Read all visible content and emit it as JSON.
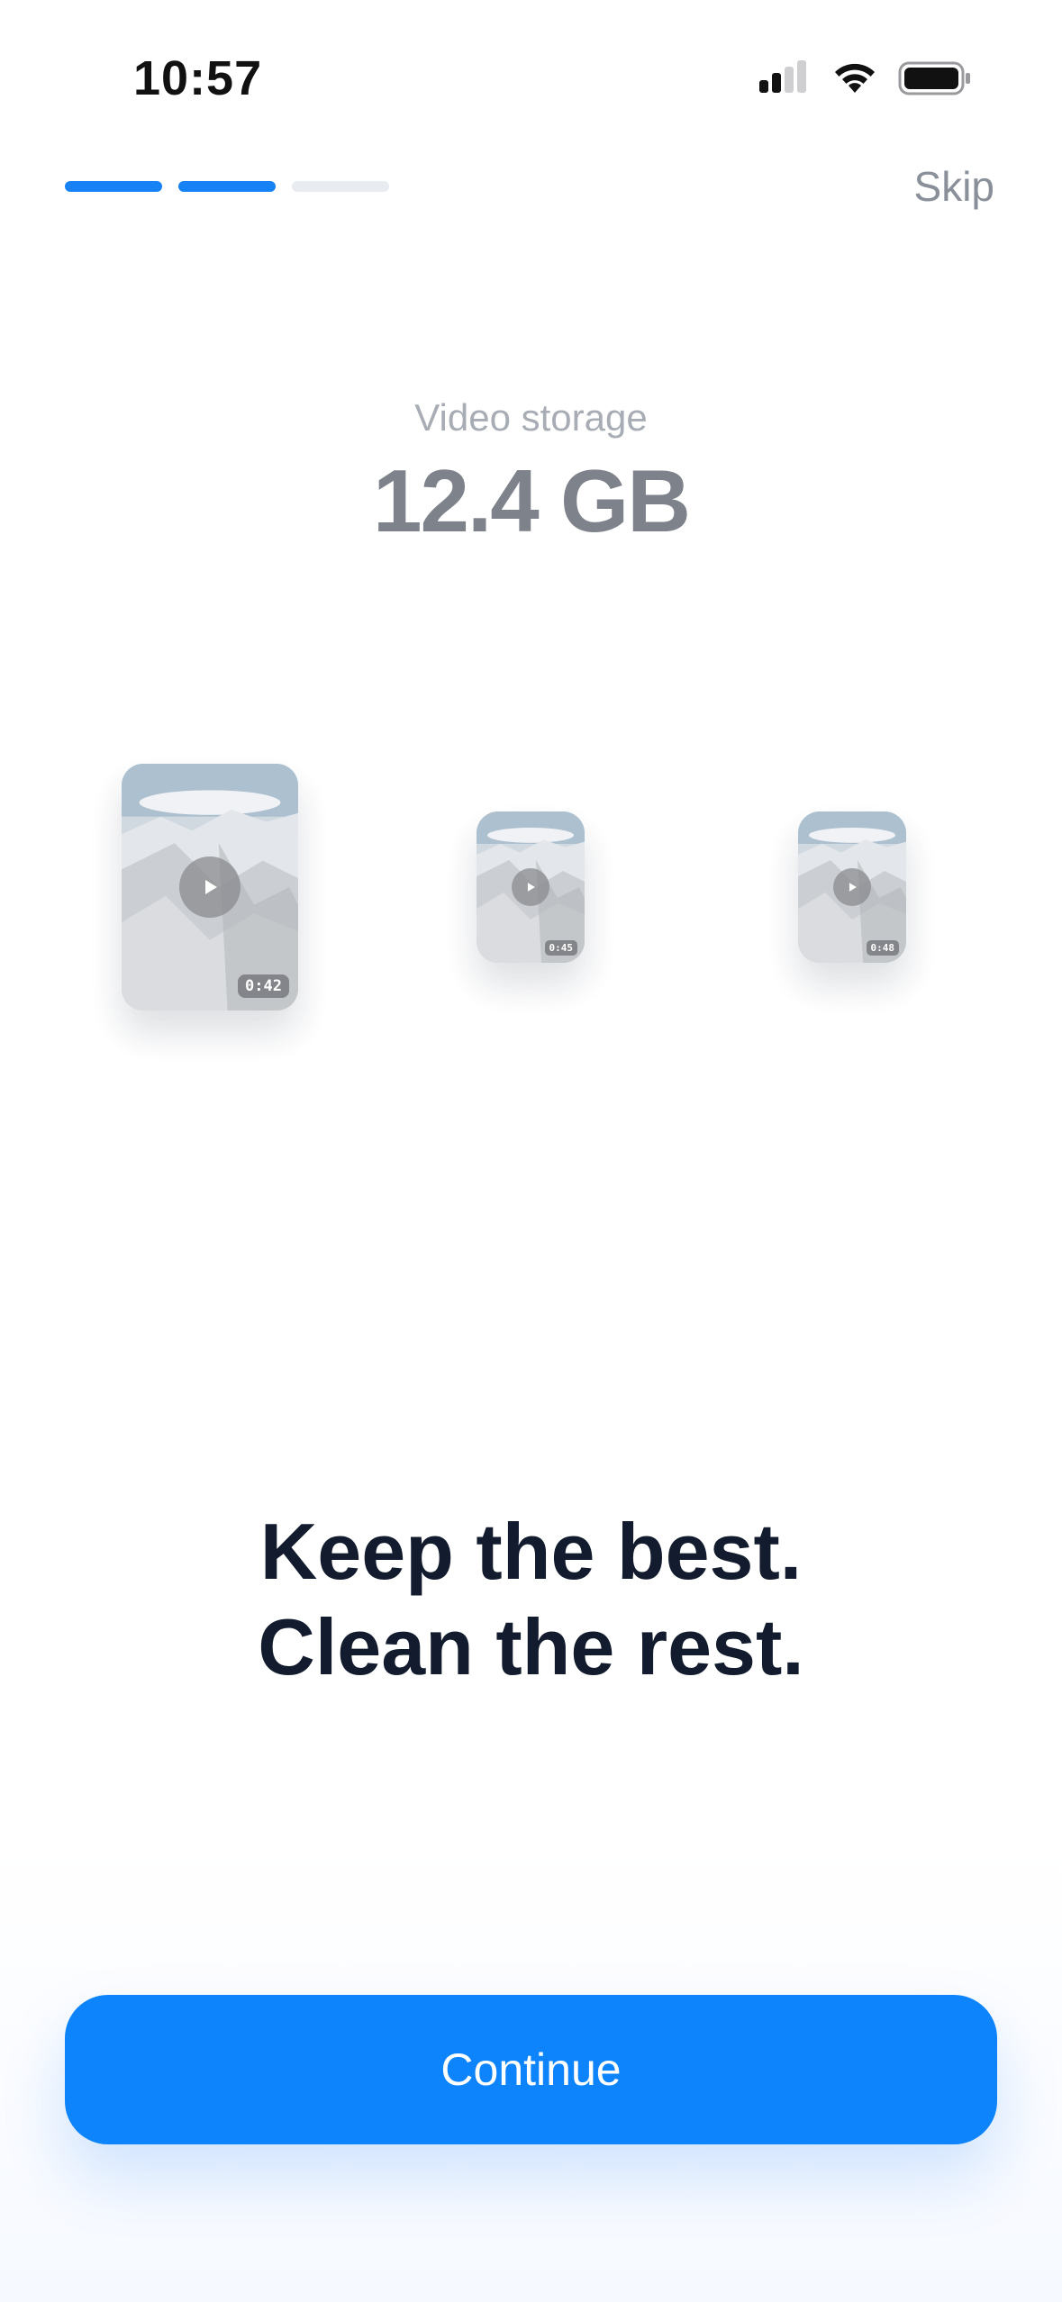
{
  "status_bar": {
    "time": "10:57",
    "icons": [
      "cellular-signal-icon",
      "wifi-icon",
      "battery-icon"
    ]
  },
  "onboarding": {
    "progress": {
      "total_steps": 3,
      "current_step": 2
    },
    "skip_label": "Skip"
  },
  "storage": {
    "label": "Video storage",
    "value": "12.4 GB"
  },
  "videos": [
    {
      "duration": "0:42"
    },
    {
      "duration": "0:45"
    },
    {
      "duration": "0:48"
    }
  ],
  "headline": {
    "line1": "Keep the best.",
    "line2": "Clean the rest."
  },
  "cta": {
    "continue_label": "Continue"
  },
  "colors": {
    "accent": "#0d84fb",
    "progress_inactive": "#e8ebf0",
    "headline": "#131c2e"
  }
}
